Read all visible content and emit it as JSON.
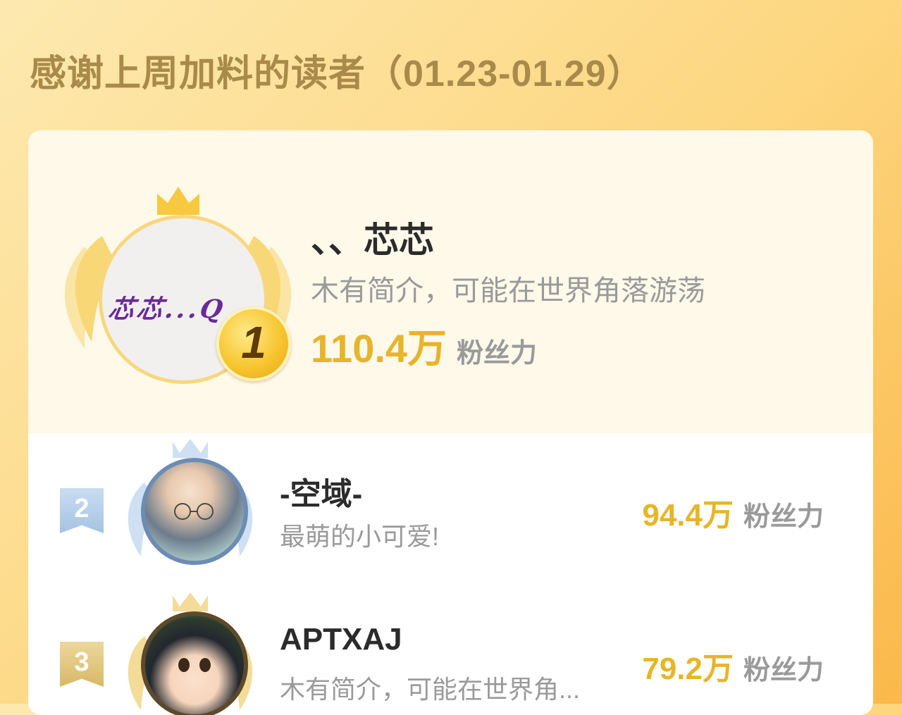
{
  "header": {
    "title": "感谢上周加料的读者（01.23-01.29）"
  },
  "readers": [
    {
      "rank": "1",
      "name": "、、芯芯",
      "intro": "木有简介，可能在世界角落游荡",
      "power_value": "110.4万",
      "power_unit": "粉丝力",
      "avatar_text": "芯芯...Q"
    },
    {
      "rank": "2",
      "name": "-空域-",
      "intro": "最萌的小可爱!",
      "power_value": "94.4万",
      "power_unit": "粉丝力"
    },
    {
      "rank": "3",
      "name": "APTXAJ",
      "intro": "木有简介，可能在世界角...",
      "power_value": "79.2万",
      "power_unit": "粉丝力"
    }
  ],
  "colors": {
    "gold": "#e7b52a",
    "silver_ribbon": "#a6c2e2",
    "bronze_ribbon": "#d8b866",
    "title": "#a98a4a"
  },
  "icons": {
    "crown": "crown-icon",
    "laurel": "laurel-wings-icon",
    "medal": "rank-medal-icon",
    "ribbon": "rank-ribbon-icon"
  }
}
